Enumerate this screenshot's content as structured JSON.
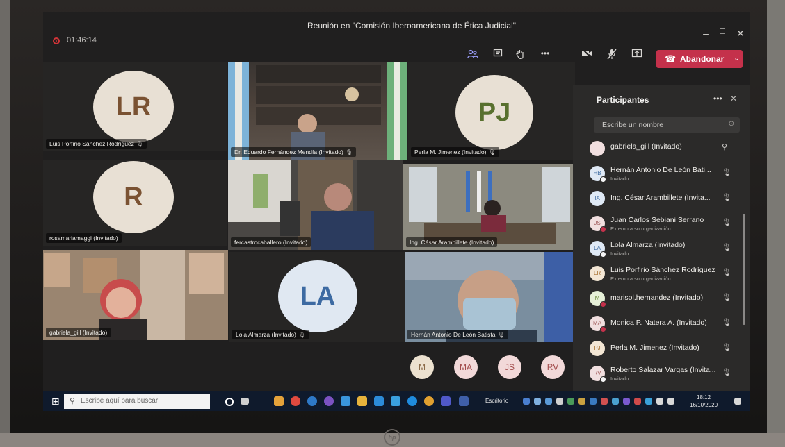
{
  "window": {
    "title": "Reunión en \"Comisión Iberoamericana de Ética Judicial\"",
    "timer": "01:46:14",
    "minimize": "–",
    "maximize": "☐",
    "close": "✕"
  },
  "toolbar": {
    "participants_icon": "people-icon",
    "chat_icon": "chat-icon",
    "raise_hand_icon": "hand-icon",
    "more_icon": "more-icon",
    "camera_icon": "camera-off-icon",
    "mic_icon": "mic-off-icon",
    "share_icon": "share-icon",
    "leave_label": "Abandonar",
    "leave_icon": "phone-icon",
    "leave_chevron": "⌄"
  },
  "tiles": [
    {
      "caption": "Luis Porfirio Sánchez Rodríguez",
      "initials": "LR"
    },
    {
      "caption": "Dr. Eduardo Fernández Mendía (Invitado)",
      "initials": ""
    },
    {
      "caption": "Perla M. Jimenez (Invitado)",
      "initials": "PJ"
    },
    {
      "caption": "rosamariamaggi (Invitado)",
      "initials": "R"
    },
    {
      "caption": "fercastrocaballero (Invitado)",
      "initials": ""
    },
    {
      "caption": "Ing. César Arambillete (Invitado)",
      "initials": ""
    },
    {
      "caption": "gabriela_gill (Invitado)",
      "initials": ""
    },
    {
      "caption": "Lola Almarza (Invitado)",
      "initials": "LA"
    },
    {
      "caption": "Hernán Antonio De León Batista",
      "initials": ""
    }
  ],
  "overflow_avatars": [
    "M",
    "MA",
    "JS",
    "RV"
  ],
  "panel": {
    "title": "Participantes",
    "more": "•••",
    "close": "✕",
    "search_placeholder": "Escribe un nombre",
    "participants": [
      {
        "initials": "",
        "name": "gabriela_gill (Invitado)",
        "sub": ""
      },
      {
        "initials": "HB",
        "name": "Hernán Antonio De León Bati...",
        "sub": "Invitado"
      },
      {
        "initials": "IA",
        "name": "Ing. César Arambillete (Invita...",
        "sub": ""
      },
      {
        "initials": "JS",
        "name": "Juan Carlos Sebiani Serrano",
        "sub": "Externo a su organización"
      },
      {
        "initials": "LA",
        "name": "Lola Almarza (Invitado)",
        "sub": "Invitado"
      },
      {
        "initials": "LR",
        "name": "Luis Porfirio Sánchez Rodríguez",
        "sub": "Externo a su organización"
      },
      {
        "initials": "M",
        "name": "marisol.hernandez (Invitado)",
        "sub": ""
      },
      {
        "initials": "MA",
        "name": "Monica P. Natera A. (Invitado)",
        "sub": ""
      },
      {
        "initials": "PJ",
        "name": "Perla M. Jimenez (Invitado)",
        "sub": ""
      },
      {
        "initials": "RV",
        "name": "Roberto Salazar Vargas (Invita...",
        "sub": "Invitado"
      }
    ]
  },
  "taskbar": {
    "search_placeholder": "Escribe aquí para buscar",
    "desktop_label": "Escritorio",
    "time": "18:12",
    "date": "16/10/2020"
  },
  "monitor": {
    "brand": "hp"
  },
  "colors": {
    "accent": "#7f85f5",
    "leave": "#c4314b",
    "panel": "#2b2a29"
  }
}
